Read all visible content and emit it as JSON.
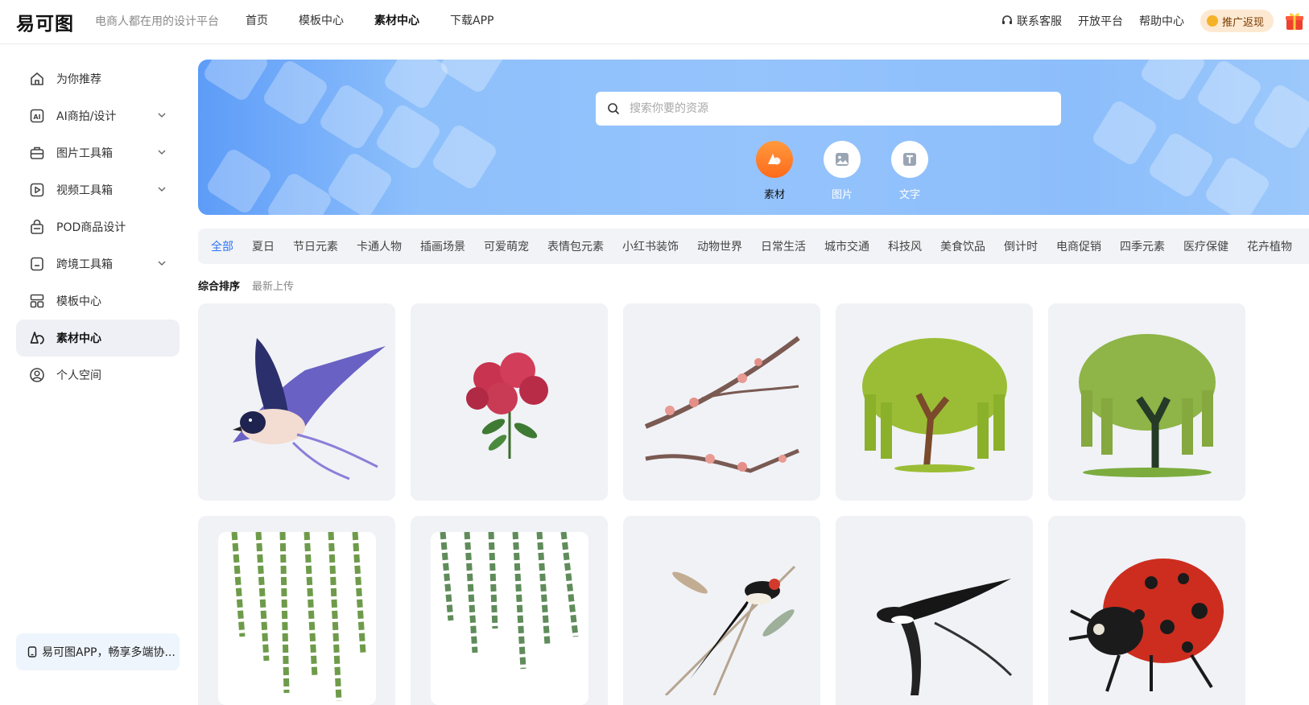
{
  "header": {
    "logo": "易可图",
    "slogan": "电商人都在用的设计平台",
    "nav": [
      {
        "label": "首页",
        "active": false
      },
      {
        "label": "模板中心",
        "active": false
      },
      {
        "label": "素材中心",
        "active": true
      },
      {
        "label": "下载APP",
        "active": false
      }
    ],
    "support": "联系客服",
    "open_platform": "开放平台",
    "help": "帮助中心",
    "promo": "推广返现"
  },
  "sidebar": {
    "items": [
      {
        "label": "为你推荐",
        "icon": "home-icon",
        "expandable": false
      },
      {
        "label": "AI商拍/设计",
        "icon": "ai-icon",
        "expandable": true
      },
      {
        "label": "图片工具箱",
        "icon": "toolbox-icon",
        "expandable": true
      },
      {
        "label": "视频工具箱",
        "icon": "video-icon",
        "expandable": true
      },
      {
        "label": "POD商品设计",
        "icon": "bag-icon",
        "expandable": false
      },
      {
        "label": "跨境工具箱",
        "icon": "bookmark-icon",
        "expandable": true
      },
      {
        "label": "模板中心",
        "icon": "layout-icon",
        "expandable": false
      },
      {
        "label": "素材中心",
        "icon": "shapes-icon",
        "expandable": false,
        "active": true
      },
      {
        "label": "个人空间",
        "icon": "user-icon",
        "expandable": false
      }
    ],
    "app_promo": "易可图APP，畅享多端协..."
  },
  "banner": {
    "search_placeholder": "搜索你要的资源",
    "categories": [
      {
        "label": "素材",
        "active": true
      },
      {
        "label": "图片",
        "active": false
      },
      {
        "label": "文字",
        "active": false
      }
    ]
  },
  "tags": [
    "全部",
    "夏日",
    "节日元素",
    "卡通人物",
    "插画场景",
    "可爱萌宠",
    "表情包元素",
    "小红书装饰",
    "动物世界",
    "日常生活",
    "城市交通",
    "科技风",
    "美食饮品",
    "倒计时",
    "电商促销",
    "四季元素",
    "医疗保健",
    "花卉植物"
  ],
  "active_tag": "全部",
  "sort": [
    {
      "label": "综合排序",
      "active": true
    },
    {
      "label": "最新上传",
      "active": false
    }
  ],
  "assets": [
    "swallow-in-flight",
    "red-rhododendron-flower",
    "plum-blossom-branches",
    "weeping-willow-tree",
    "willow-tree-on-grass",
    "hanging-willow-leaves",
    "willow-branches",
    "swallow-on-reeds",
    "ink-swallow",
    "ladybug"
  ],
  "colors": {
    "accent": "#2f73f6",
    "banner": "#8ec0fb",
    "orange": "#ff7a22"
  }
}
